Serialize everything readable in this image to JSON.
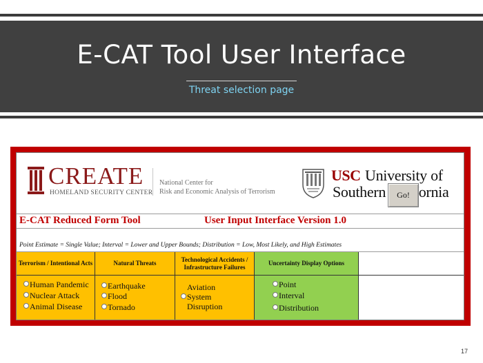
{
  "slide": {
    "title": "E-CAT Tool User Interface",
    "subtitle": "Threat selection page",
    "page_number": "17"
  },
  "logos": {
    "create_wordmark": "CREATE",
    "create_sub": "HOMELAND SECURITY CENTER",
    "create_desc_line1": "National Center for",
    "create_desc_line2": "Risk and Economic Analysis of Terrorism",
    "usc_mark": "USC",
    "usc_name_line1": "University of",
    "usc_name_line2": "Southern California"
  },
  "tool": {
    "name": "E-CAT Reduced Form Tool",
    "version_label": "User Input Interface Version 1.0",
    "legend": "Point Estimate = Single Value;  Interval = Lower and Upper Bounds;  Distribution = Low, Most Likely, and High Estimates"
  },
  "columns": [
    {
      "header": "Terrorism / Intentional Acts",
      "options": [
        "Human Pandemic",
        "Nuclear Attack",
        "Animal Disease"
      ]
    },
    {
      "header": "Natural Threats",
      "options": [
        "Earthquake",
        "Flood",
        "Tornado"
      ]
    },
    {
      "header": "Technological Accidents / Infrastructure Failures",
      "options": [
        "Aviation",
        "System",
        "Disruption"
      ]
    },
    {
      "header": "Uncertainty Display Options",
      "options": [
        "Point",
        "Interval",
        "Distribution"
      ]
    }
  ],
  "go_button": "Go!",
  "colors": {
    "banner": "#404040",
    "subtitle": "#7fd4f2",
    "frame": "#c00000",
    "threat_cells": "#ffc000",
    "uncertainty_cells": "#92d050"
  }
}
